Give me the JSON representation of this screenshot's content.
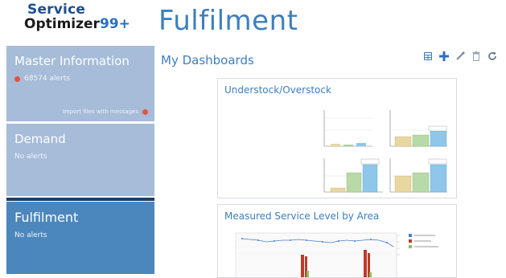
{
  "logo": {
    "line1": "Service",
    "line2_word": "Optimizer",
    "line2_num": "99+"
  },
  "page_title": "Fulfilment",
  "sidebar": {
    "master": {
      "title": "Master Information",
      "alerts": "68574 alerts",
      "link": "Import files with messages"
    },
    "demand": {
      "title": "Demand",
      "alerts": "No alerts"
    },
    "fulfilment": {
      "title": "Fulfilment",
      "alerts": "No alerts"
    }
  },
  "dashboards": {
    "heading": "My Dashboards",
    "toolbar": [
      "grid-icon",
      "add-icon",
      "edit-icon",
      "delete-icon",
      "refresh-icon"
    ],
    "cards": [
      {
        "title": "Understock/Overstock"
      },
      {
        "title": "Measured Service Level by Area"
      }
    ]
  },
  "colors": {
    "accent": "#3d7fbf",
    "panel_inactive": "#a6bcd8",
    "panel_active": "#4b87bd",
    "alert_dot": "#e5533c"
  }
}
